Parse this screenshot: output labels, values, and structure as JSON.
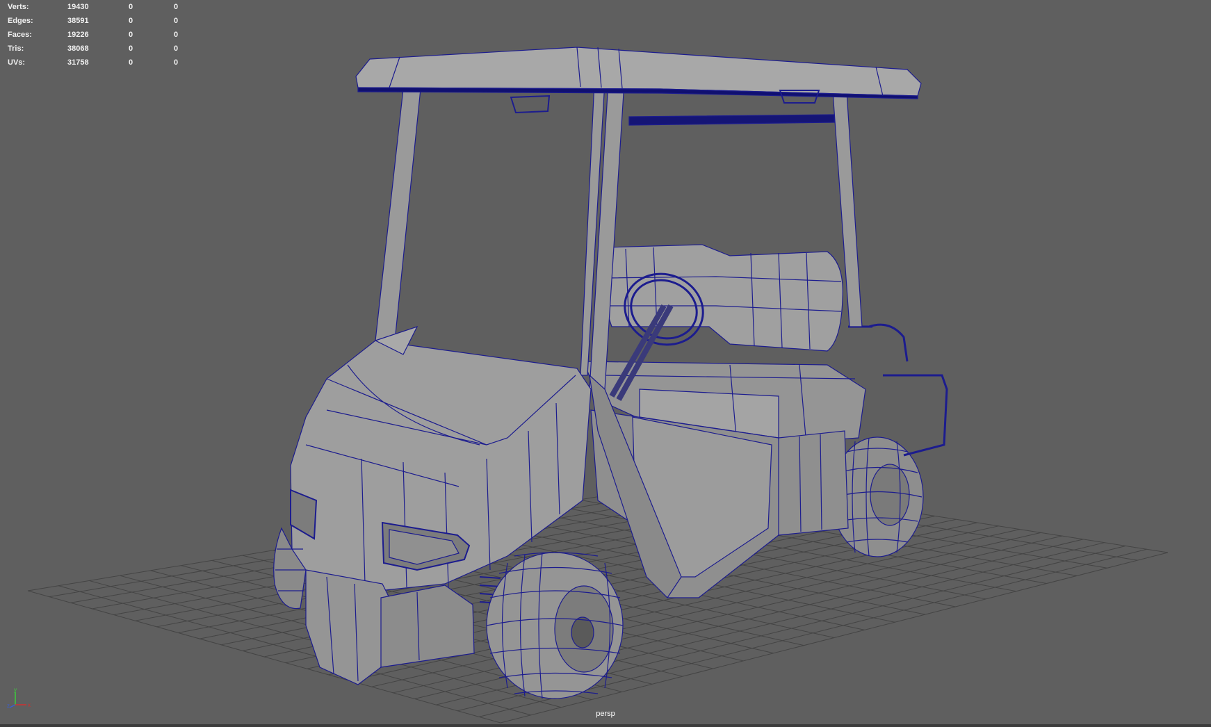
{
  "hud": {
    "rows": [
      {
        "label": "Verts:",
        "v1": "19430",
        "v2": "0",
        "v3": "0"
      },
      {
        "label": "Edges:",
        "v1": "38591",
        "v2": "0",
        "v3": "0"
      },
      {
        "label": "Faces:",
        "v1": "19226",
        "v2": "0",
        "v3": "0"
      },
      {
        "label": "Tris:",
        "v1": "38068",
        "v2": "0",
        "v3": "0"
      },
      {
        "label": "UVs:",
        "v1": "31758",
        "v2": "0",
        "v3": "0"
      }
    ]
  },
  "viewport": {
    "camera": "persp",
    "background_color": "#5f5f5f",
    "wire_color": "#1a1a8c",
    "mesh_fill": "#9a9a9a",
    "grid_color": "#444444"
  },
  "axis_gizmo": {
    "x": "x",
    "y": "y",
    "z": "z"
  }
}
